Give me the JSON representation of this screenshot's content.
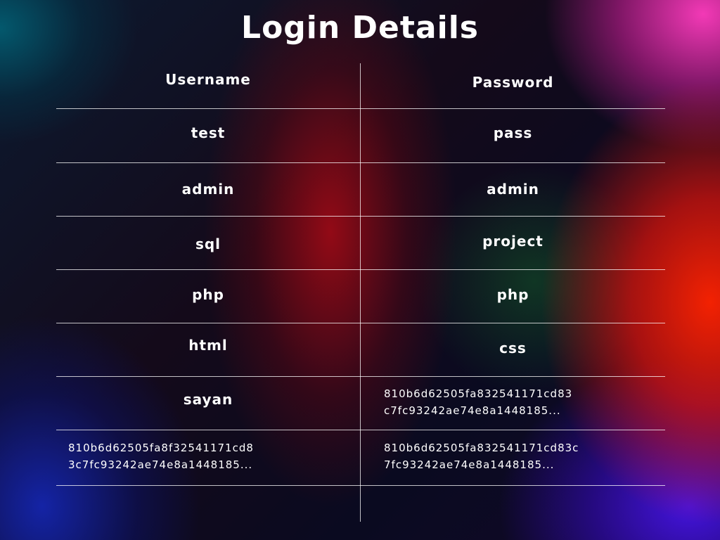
{
  "title": "Login Details",
  "table": {
    "headers": {
      "username": "Username",
      "password": "Password"
    },
    "rows": [
      {
        "username": "test",
        "password": "pass"
      },
      {
        "username": "admin",
        "password": "admin"
      },
      {
        "username": "sql",
        "password": "project"
      },
      {
        "username": "php",
        "password": "php"
      },
      {
        "username": "html",
        "password": "css"
      },
      {
        "username": "sayan",
        "password": "810b6d62505fa832541171cd83\nc7fc93242ae74e8a1448185..."
      },
      {
        "username": "810b6d62505fa8f32541171cd8\n3c7fc93242ae74e8a1448185...",
        "password": "810b6d62505fa832541171cd83c\n7fc93242ae74e8a1448185..."
      }
    ]
  },
  "colors": {
    "text": "#ffffff",
    "rule": "#ffffff"
  }
}
